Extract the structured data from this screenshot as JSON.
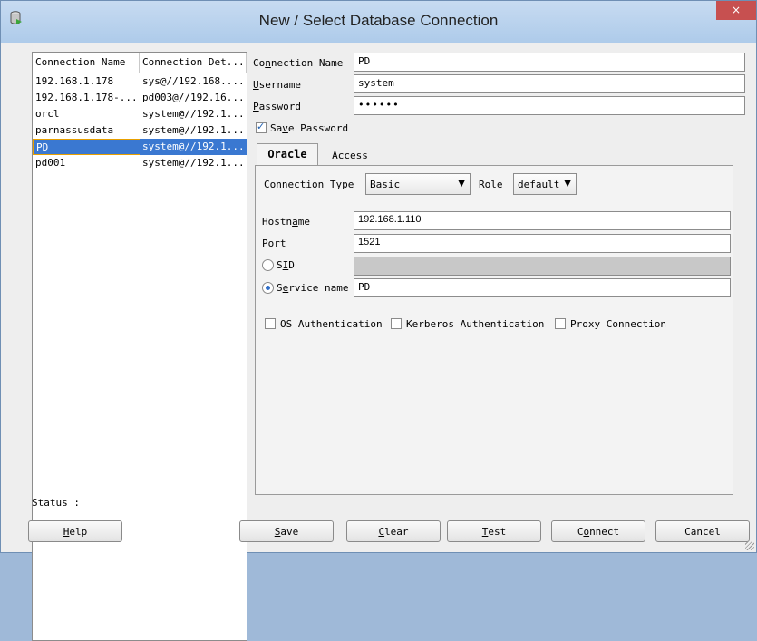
{
  "window": {
    "title": "New / Select Database Connection",
    "close_glyph": "×",
    "icon": "database-icon"
  },
  "list": {
    "columns": [
      "Connection Name",
      "Connection Det..."
    ],
    "rows": [
      {
        "name": "192.168.1.178",
        "detail": "sys@//192.168....",
        "selected": false
      },
      {
        "name": "192.168.1.178-...",
        "detail": "pd003@//192.16...",
        "selected": false
      },
      {
        "name": "orcl",
        "detail": "system@//192.1...",
        "selected": false
      },
      {
        "name": "parnassusdata",
        "detail": "system@//192.1...",
        "selected": false
      },
      {
        "name": "PD",
        "detail": "system@//192.1...",
        "selected": true
      },
      {
        "name": "pd001",
        "detail": "system@//192.1...",
        "selected": false
      }
    ]
  },
  "form": {
    "conn_name_label_pre": "Co",
    "conn_name_label_u": "n",
    "conn_name_label_post": "nection Name",
    "conn_name_value": "PD",
    "username_label_u": "U",
    "username_label_post": "sername",
    "username_value": "system",
    "password_label_u": "P",
    "password_label_post": "assword",
    "password_value": "••••••",
    "save_pw_pre": "Sa",
    "save_pw_u": "v",
    "save_pw_post": "e Password",
    "save_pw_checked": true
  },
  "tabs": {
    "oracle": "Oracle",
    "access": "Access"
  },
  "oracle": {
    "conn_type_label_pre": "Connection T",
    "conn_type_label_u": "y",
    "conn_type_label_post": "pe",
    "conn_type_value": "Basic",
    "role_label_pre": "Ro",
    "role_label_u": "l",
    "role_label_post": "e",
    "role_value": "default",
    "hostname_label_pre": "Hostn",
    "hostname_label_u": "a",
    "hostname_label_post": "me",
    "hostname_value": "192.168.1.110",
    "port_label_pre": "Po",
    "port_label_u": "r",
    "port_label_post": "t",
    "port_value": "1521",
    "sid_label_pre": "S",
    "sid_label_u": "I",
    "sid_label_post": "D",
    "sid_value": "",
    "service_label_pre": "S",
    "service_label_u": "e",
    "service_label_post": "rvice name",
    "service_value": "PD",
    "os_auth": "OS Authentication",
    "kerberos_auth": "Kerberos Authentication",
    "proxy": "Proxy Connection"
  },
  "status": {
    "label": "Status :"
  },
  "buttons": {
    "help_u": "H",
    "help_post": "elp",
    "save_u": "S",
    "save_post": "ave",
    "clear_u": "C",
    "clear_post": "lear",
    "test_u": "T",
    "test_post": "est",
    "connect_pre": "C",
    "connect_u": "o",
    "connect_post": "nnect",
    "cancel": "Cancel"
  }
}
